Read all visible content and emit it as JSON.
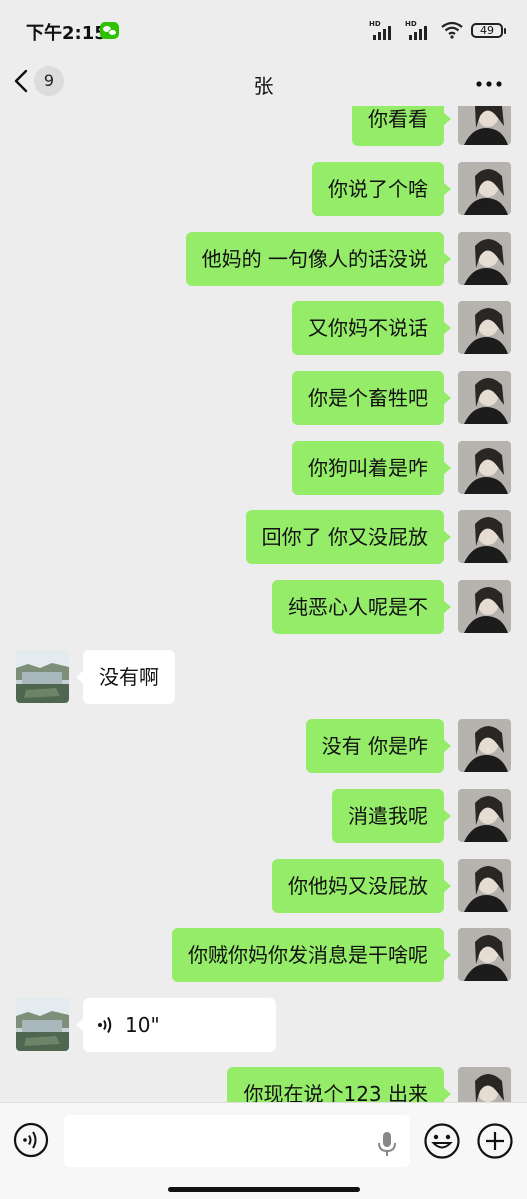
{
  "status_bar": {
    "time": "下午2:15",
    "network": "HD",
    "battery": "49"
  },
  "nav": {
    "back_count": "9",
    "title": "张"
  },
  "messages": [
    {
      "from": "me",
      "text": "你看看"
    },
    {
      "from": "me",
      "text": "你说了个啥"
    },
    {
      "from": "me",
      "text": "他妈的 一句像人的话没说"
    },
    {
      "from": "me",
      "text": "又你妈不说话"
    },
    {
      "from": "me",
      "text": "你是个畜牲吧"
    },
    {
      "from": "me",
      "text": "你狗叫着是咋"
    },
    {
      "from": "me",
      "text": "回你了 你又没屁放"
    },
    {
      "from": "me",
      "text": "纯恶心人呢是不"
    },
    {
      "from": "them",
      "text": "没有啊"
    },
    {
      "from": "me",
      "text": "没有 你是咋"
    },
    {
      "from": "me",
      "text": "消遣我呢"
    },
    {
      "from": "me",
      "text": "你他妈又没屁放"
    },
    {
      "from": "me",
      "text": "你贼你妈你发消息是干啥呢"
    },
    {
      "from": "them",
      "type": "voice",
      "duration": "10\""
    },
    {
      "from": "me",
      "text": "你现在说个123 出来"
    }
  ],
  "colors": {
    "outgoing_bubble": "#95ec69",
    "incoming_bubble": "#ffffff",
    "background": "#ededed"
  }
}
